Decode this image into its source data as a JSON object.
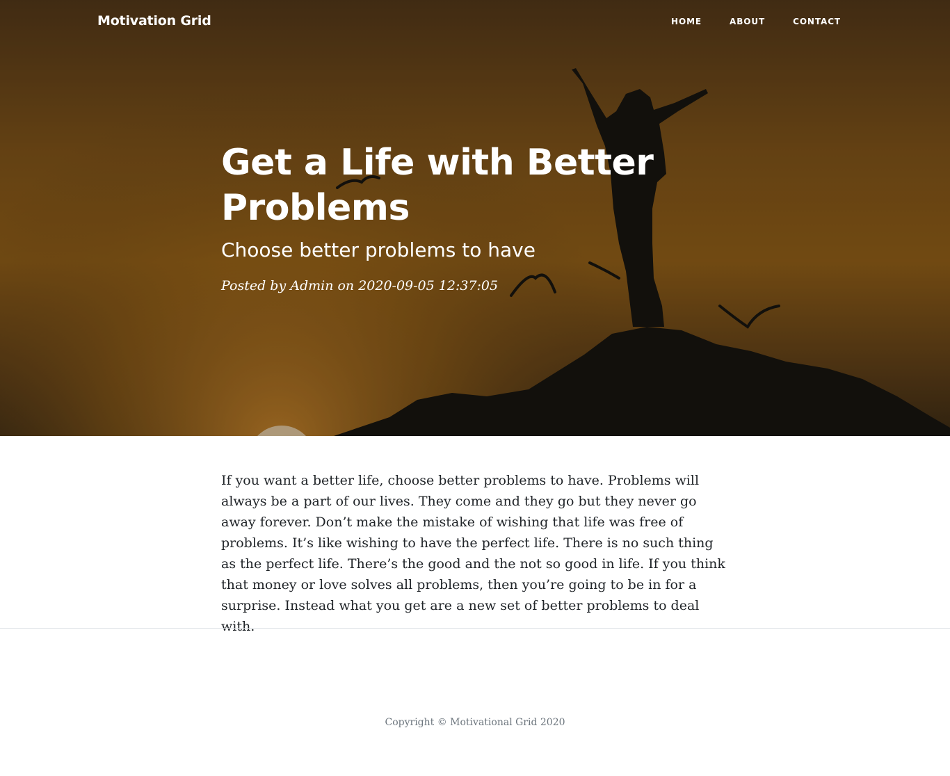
{
  "navbar": {
    "brand": "Motivation Grid",
    "links": [
      {
        "label": "HOME"
      },
      {
        "label": "ABOUT"
      },
      {
        "label": "CONTACT"
      }
    ]
  },
  "post": {
    "title": "Get a Life with Better Problems",
    "subtitle": "Choose better problems to have",
    "meta": "Posted by Admin on 2020-09-05 12:37:05",
    "body": "If you want a better life, choose better problems to have. Problems will always be a part of our lives. They come and they go but they never go away forever. Don’t make the mistake of wishing that life was free of problems. It’s like wishing to have the perfect life. There is no such thing as the perfect life. There’s the good and the not so good in life. If you think that money or love solves all problems, then you’re going to be in for a surprise. Instead what you get are a new set of better problems to deal with."
  },
  "footer": {
    "copyright": "Copyright © Motivational Grid 2020"
  },
  "colors": {
    "hero_sunset": "#8a5a17",
    "silhouette": "#17140f",
    "text": "#212529",
    "muted": "#6c757d"
  }
}
